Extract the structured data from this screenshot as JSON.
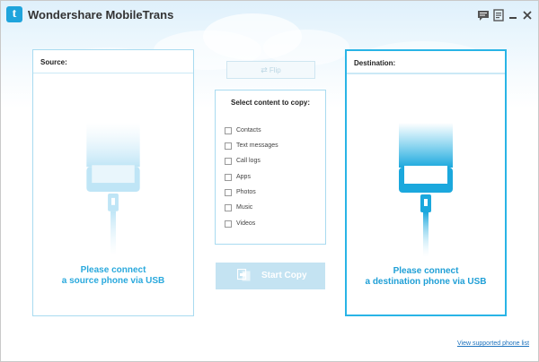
{
  "window": {
    "title": "Wondershare MobileTrans",
    "logo_letter": "t"
  },
  "titlebar": {
    "icons": [
      "feedback-icon",
      "register-icon",
      "minimize-icon",
      "close-icon"
    ]
  },
  "source": {
    "heading": "Source:",
    "line1": "Please connect",
    "line2": "a source phone via USB"
  },
  "destination": {
    "heading": "Destination:",
    "line1": "Please connect",
    "line2": "a destination phone via USB"
  },
  "flip": {
    "label": "Flip"
  },
  "content": {
    "title": "Select content to copy:",
    "items": [
      "Contacts",
      "Text messages",
      "Call logs",
      "Apps",
      "Photos",
      "Music",
      "Videos"
    ]
  },
  "start_copy": {
    "label": "Start Copy"
  },
  "footer": {
    "link": "View supported phone list"
  },
  "colors": {
    "accent": "#29b4e6",
    "light_accent": "#a9dbf0",
    "disabled_button": "#c4e3f2",
    "link": "#1e73be"
  }
}
